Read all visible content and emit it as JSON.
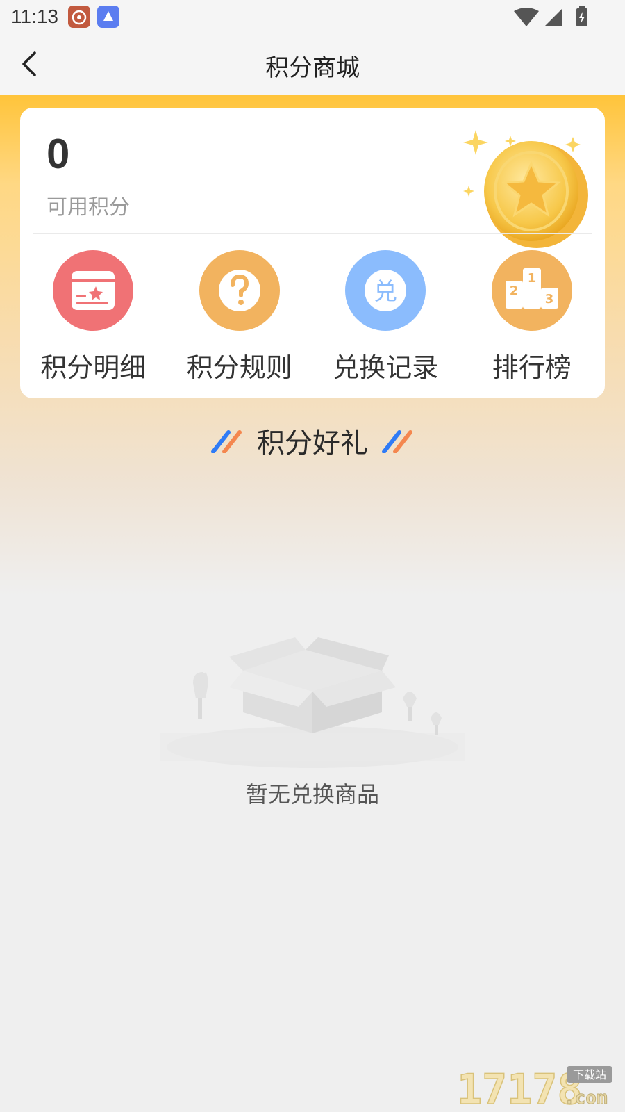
{
  "status_bar": {
    "time": "11:13"
  },
  "header": {
    "title": "积分商城"
  },
  "points": {
    "value": "0",
    "label": "可用积分"
  },
  "menu": [
    {
      "label": "积分明细",
      "color": "#f07275",
      "icon": "points-detail-icon"
    },
    {
      "label": "积分规则",
      "color": "#f2b35f",
      "icon": "question-icon"
    },
    {
      "label": "兑换记录",
      "color": "#8bbcfd",
      "icon": "exchange-icon",
      "glyph": "兑"
    },
    {
      "label": "排行榜",
      "color": "#f2b35f",
      "icon": "podium-icon"
    }
  ],
  "section": {
    "title": "积分好礼"
  },
  "empty_state": {
    "text": "暂无兑换商品"
  },
  "watermark": {
    "text": "17178",
    "sub": "下载站",
    "suffix": ".com"
  },
  "colors": {
    "accent": "#ffc43a",
    "slash_blue": "#2f7bf6",
    "slash_orange": "#f4874f"
  }
}
